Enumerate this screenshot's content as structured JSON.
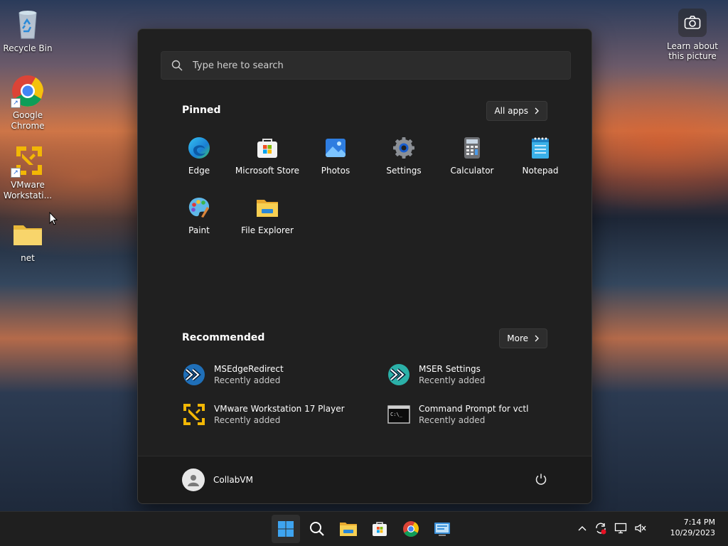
{
  "desktop": {
    "icons": [
      {
        "label": "Recycle Bin"
      },
      {
        "label": "Google Chrome"
      },
      {
        "label": "VMware Workstati..."
      },
      {
        "label": "net"
      }
    ],
    "learn_label": "Learn about this picture"
  },
  "start_menu": {
    "search_placeholder": "Type here to search",
    "pinned_title": "Pinned",
    "all_apps_label": "All apps",
    "pinned": [
      {
        "label": "Edge",
        "icon": "edge-icon"
      },
      {
        "label": "Microsoft Store",
        "icon": "store-icon"
      },
      {
        "label": "Photos",
        "icon": "photos-icon"
      },
      {
        "label": "Settings",
        "icon": "settings-icon"
      },
      {
        "label": "Calculator",
        "icon": "calculator-icon"
      },
      {
        "label": "Notepad",
        "icon": "notepad-icon"
      },
      {
        "label": "Paint",
        "icon": "paint-icon"
      },
      {
        "label": "File Explorer",
        "icon": "folder-icon"
      }
    ],
    "recommended_title": "Recommended",
    "more_label": "More",
    "recommended": [
      {
        "name": "MSEdgeRedirect",
        "sub": "Recently added"
      },
      {
        "name": "MSER Settings",
        "sub": "Recently added"
      },
      {
        "name": "VMware Workstation 17 Player",
        "sub": "Recently added"
      },
      {
        "name": "Command Prompt for vctl",
        "sub": "Recently added"
      }
    ],
    "user_name": "CollabVM"
  },
  "taskbar": {
    "time": "7:14 PM",
    "date": "10/29/2023"
  }
}
